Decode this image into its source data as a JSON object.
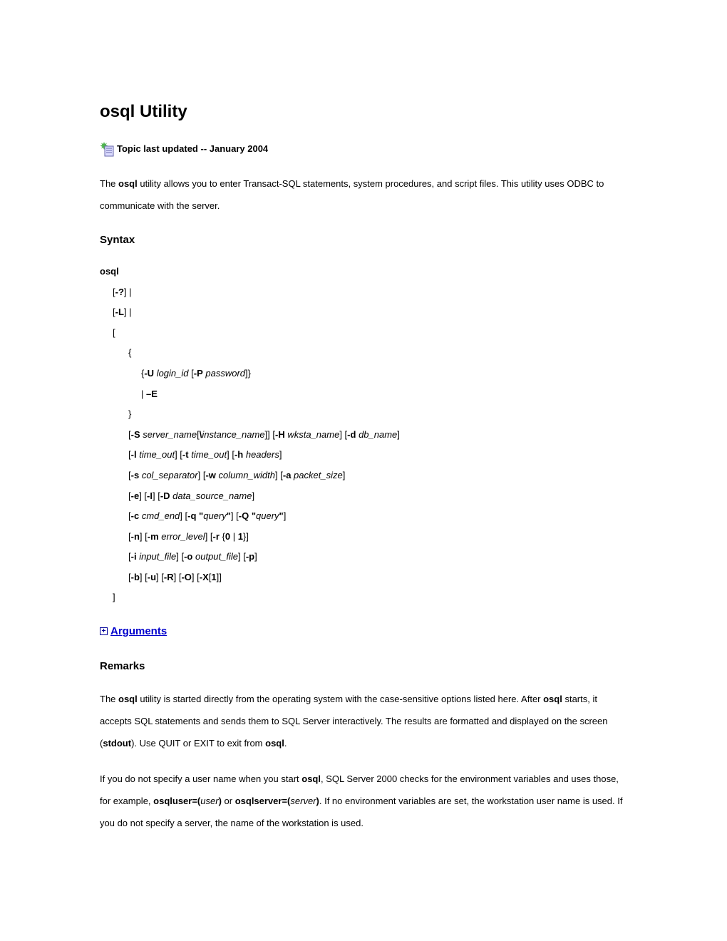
{
  "title": "osql Utility",
  "topic_updated": "Topic last updated -- January 2004",
  "intro_parts": {
    "p1": "The ",
    "b1": "osql",
    "p2": " utility allows you to enter Transact-SQL statements, system procedures, and script files. This utility uses ODBC to communicate with the server."
  },
  "syntax_heading": "Syntax",
  "syntax": {
    "cmd": "osql",
    "opt_question": "-?",
    "opt_L": "-L",
    "opt_U": "-U",
    "opt_P": "-P",
    "opt_E": "–E",
    "opt_S": "-S",
    "opt_H": "-H",
    "opt_d": "-d",
    "opt_l": "-l",
    "opt_t": "-t",
    "opt_h": "-h",
    "opt_s": "-s",
    "opt_w": "-w",
    "opt_a": "-a",
    "opt_e": "-e",
    "opt_I": "-I",
    "opt_D": "-D",
    "opt_c": "-c",
    "opt_q": "-q",
    "opt_Q": "-Q",
    "opt_n": "-n",
    "opt_m": "-m",
    "opt_r": "-r",
    "opt_i": "-i",
    "opt_o": "-o",
    "opt_p": "-p",
    "opt_b": "-b",
    "opt_u": "-u",
    "opt_R": "-R",
    "opt_O": "-O",
    "opt_X": "-X",
    "arg_login_id": "login_id",
    "arg_password": "password",
    "arg_server_name": "server_name",
    "arg_instance_name": "instance_name",
    "arg_wksta_name": "wksta_name",
    "arg_db_name": "db_name",
    "arg_time_out": "time_out",
    "arg_headers": "headers",
    "arg_col_separator": "col_separator",
    "arg_column_width": "column_width",
    "arg_packet_size": "packet_size",
    "arg_data_source_name": "data_source_name",
    "arg_cmd_end": "cmd_end",
    "arg_query": "query",
    "arg_error_level": "error_level",
    "arg_input_file": "input_file",
    "arg_output_file": "output_file",
    "lit_0": "0",
    "lit_1": "1",
    "lit_backslash": "\\",
    "lit_quote": "\""
  },
  "arguments_label": "Arguments",
  "remarks_heading": "Remarks",
  "remarks": {
    "p1_a": "The ",
    "p1_b1": "osql",
    "p1_b": " utility is started directly from the operating system with the case-sensitive options listed here. After ",
    "p1_b2": "osql",
    "p1_c": " starts, it accepts SQL statements and sends them to SQL Server interactively. The results are formatted and displayed on the screen (",
    "p1_b3": "stdout",
    "p1_d": "). Use QUIT or EXIT to exit from ",
    "p1_b4": "osql",
    "p1_e": ".",
    "p2_a": "If you do not specify a user name when you start ",
    "p2_b1": "osql",
    "p2_b": ", SQL Server 2000 checks for the environment variables and uses those, for example, ",
    "p2_b2": "osqluser=(",
    "p2_i1": "user",
    "p2_b3": ")",
    "p2_c": " or ",
    "p2_b4": "osqlserver=(",
    "p2_i2": "server",
    "p2_b5": ")",
    "p2_d": ". If no environment variables are set, the workstation user name is used. If you do not specify a server, the name of the workstation is used."
  }
}
